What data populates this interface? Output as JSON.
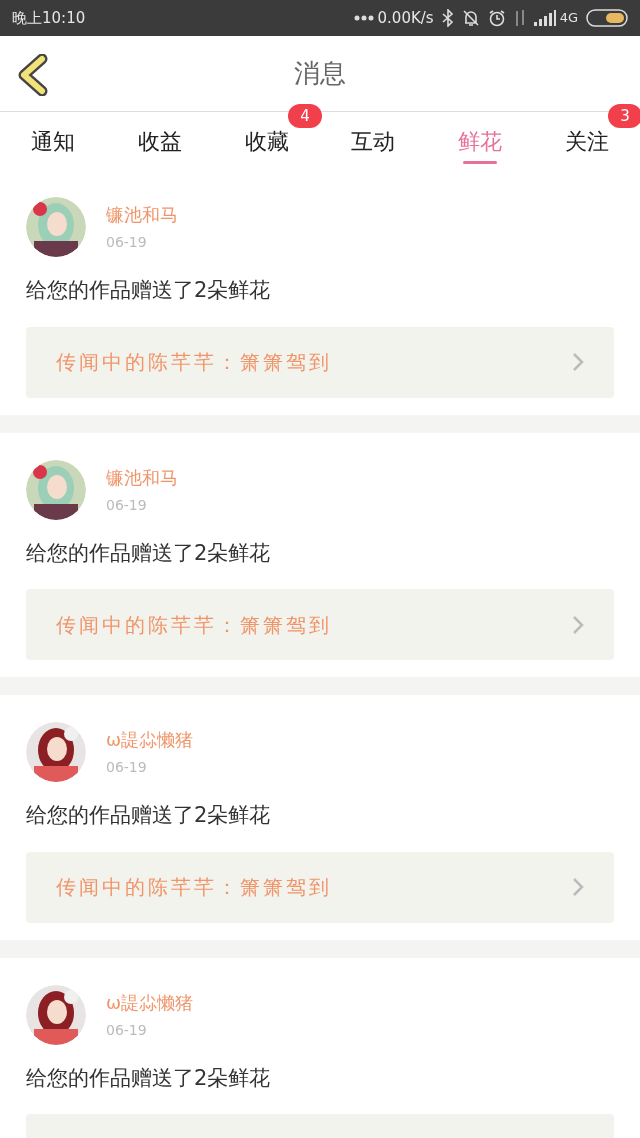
{
  "status_bar": {
    "time": "晚上10:10",
    "speed": "0.00K/s",
    "network": "4G"
  },
  "header": {
    "title": "消息"
  },
  "tabs": [
    {
      "label": "通知",
      "selected": false
    },
    {
      "label": "收益",
      "selected": false
    },
    {
      "label": "收藏",
      "selected": false,
      "badge": "4"
    },
    {
      "label": "互动",
      "selected": false
    },
    {
      "label": "鲜花",
      "selected": true
    },
    {
      "label": "关注",
      "selected": false,
      "badge": "3"
    }
  ],
  "messages": [
    {
      "user": "镰池和马",
      "date": "06-19",
      "text": "给您的作品赠送了2朵鲜花",
      "work": "传闻中的陈芊芊：箫箫驾到"
    },
    {
      "user": "镰池和马",
      "date": "06-19",
      "text": "给您的作品赠送了2朵鲜花",
      "work": "传闻中的陈芊芊：箫箫驾到"
    },
    {
      "user": "ω諟尛懒猪",
      "date": "06-19",
      "text": "给您的作品赠送了2朵鲜花",
      "work": "传闻中的陈芊芊：箫箫驾到"
    },
    {
      "user": "ω諟尛懒猪",
      "date": "06-19",
      "text": "给您的作品赠送了2朵鲜花"
    }
  ]
}
